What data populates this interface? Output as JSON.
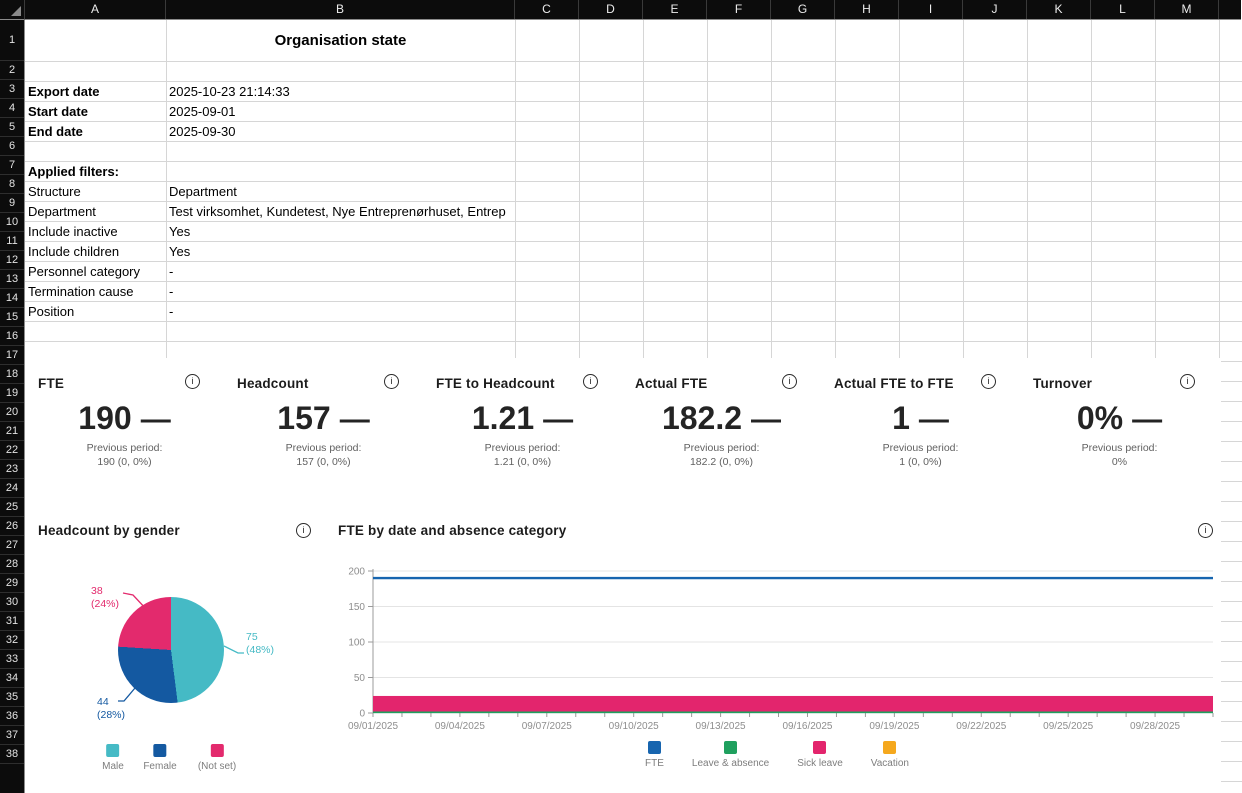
{
  "icons": {
    "info": "i",
    "select_all_corner": "triangle"
  },
  "sheet": {
    "title": "Organisation state",
    "columns": [
      "A",
      "B",
      "C",
      "D",
      "E",
      "F",
      "G",
      "H",
      "I",
      "J",
      "K",
      "L",
      "M"
    ],
    "visible_rows": 38,
    "cells": [
      {
        "row": 3,
        "a": "Export date",
        "b": "2025-10-23 21:14:33",
        "bold": true
      },
      {
        "row": 4,
        "a": "Start date",
        "b": "2025-09-01",
        "bold": true
      },
      {
        "row": 5,
        "a": "End date",
        "b": "2025-09-30",
        "bold": true
      },
      {
        "row": 7,
        "a": "Applied filters:",
        "b": "",
        "bold": true
      },
      {
        "row": 8,
        "a": "Structure",
        "b": "Department",
        "bold": false
      },
      {
        "row": 9,
        "a": "Department",
        "b": "Test virksomhet, Kundetest, Nye Entreprenørhuset, Entrep",
        "bold": false
      },
      {
        "row": 10,
        "a": "Include inactive",
        "b": "Yes",
        "bold": false
      },
      {
        "row": 11,
        "a": "Include children",
        "b": "Yes",
        "bold": false
      },
      {
        "row": 12,
        "a": "Personnel category",
        "b": "-",
        "bold": false
      },
      {
        "row": 13,
        "a": "Termination cause",
        "b": "-",
        "bold": false
      },
      {
        "row": 14,
        "a": "Position",
        "b": "-",
        "bold": false
      }
    ]
  },
  "kpis": [
    {
      "title": "FTE",
      "value": "190",
      "trend": "—",
      "prev_label": "Previous period:",
      "prev": "190 (0, 0%)"
    },
    {
      "title": "Headcount",
      "value": "157",
      "trend": "—",
      "prev_label": "Previous period:",
      "prev": "157 (0, 0%)"
    },
    {
      "title": "FTE to Headcount",
      "value": "1.21",
      "trend": "—",
      "prev_label": "Previous period:",
      "prev": "1.21 (0, 0%)"
    },
    {
      "title": "Actual FTE",
      "value": "182.2",
      "trend": "—",
      "prev_label": "Previous period:",
      "prev": "182.2 (0, 0%)"
    },
    {
      "title": "Actual FTE to FTE",
      "value": "1",
      "trend": "—",
      "prev_label": "Previous period:",
      "prev": "1 (0, 0%)"
    },
    {
      "title": "Turnover",
      "value": "0%",
      "trend": "—",
      "prev_label": "Previous period:",
      "prev": "0%"
    }
  ],
  "chart_data": [
    {
      "type": "pie",
      "title": "Headcount by gender",
      "labels": [
        "Male",
        "Female",
        "(Not set)"
      ],
      "values": [
        75,
        44,
        38
      ],
      "percents": [
        48,
        28,
        24
      ],
      "colors": [
        "#45BAC5",
        "#1459A1",
        "#E32A6D"
      ],
      "legend_position": "bottom",
      "start_angle_deg": 0,
      "direction": "clockwise"
    },
    {
      "type": "line",
      "title": "FTE by date and absence category",
      "x_ticks": [
        "09/01/2025",
        "09/04/2025",
        "09/07/2025",
        "09/10/2025",
        "09/13/2025",
        "09/16/2025",
        "09/19/2025",
        "09/22/2025",
        "09/25/2025",
        "09/28/2025"
      ],
      "x_range": [
        "09/01/2025",
        "09/30/2025"
      ],
      "days_total": 30,
      "x_tick_step_days": 3,
      "ylim": [
        0,
        200
      ],
      "y_ticks": [
        0,
        50,
        100,
        150,
        200
      ],
      "grid": "horizontal",
      "legend_position": "bottom",
      "series": [
        {
          "name": "FTE",
          "color": "#1765AF",
          "style": "line",
          "value_constant": 190
        },
        {
          "name": "Leave & absence",
          "color": "#1FA05E",
          "style": "line",
          "value_constant": 1
        },
        {
          "name": "Sick leave",
          "color": "#E3256D",
          "style": "band",
          "value_constant": 13,
          "band": [
            2,
            24
          ]
        },
        {
          "name": "Vacation",
          "color": "#F5A81D",
          "style": "line",
          "value_constant": 0
        }
      ]
    }
  ]
}
